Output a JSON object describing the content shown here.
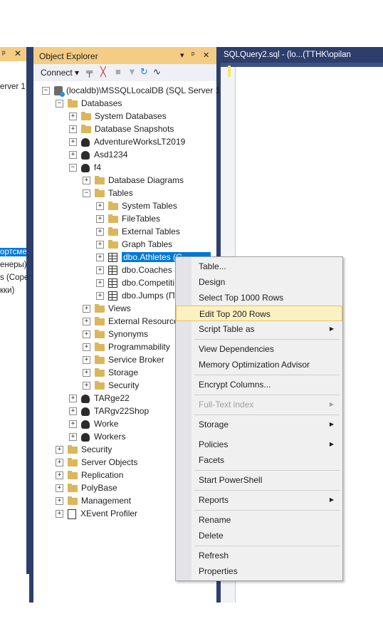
{
  "left_panel": {
    "header_icons": [
      "pin-icon",
      "close-icon"
    ],
    "lines": [
      "erver 1",
      "ортсме",
      "енеры)",
      "s (Соре",
      "кки)"
    ]
  },
  "object_explorer": {
    "title": "Object Explorer",
    "connect_label": "Connect",
    "tree": [
      {
        "label": "(localdb)\\MSSQLLocalDB (SQL Server 1",
        "icon": "server-icon",
        "expander": "−"
      },
      {
        "label": "Databases",
        "icon": "folder-icon",
        "expander": "−"
      },
      {
        "label": "System Databases",
        "icon": "folder-icon",
        "expander": "+"
      },
      {
        "label": "Database Snapshots",
        "icon": "folder-icon",
        "expander": "+"
      },
      {
        "label": "AdventureWorksLT2019",
        "icon": "database-icon",
        "expander": "+"
      },
      {
        "label": "Asd1234",
        "icon": "database-icon",
        "expander": "+"
      },
      {
        "label": "f4",
        "icon": "database-icon",
        "expander": "−"
      },
      {
        "label": "Database Diagrams",
        "icon": "folder-icon",
        "expander": "+"
      },
      {
        "label": "Tables",
        "icon": "folder-icon",
        "expander": "−"
      },
      {
        "label": "System Tables",
        "icon": "folder-icon",
        "expander": "+"
      },
      {
        "label": "FileTables",
        "icon": "folder-icon",
        "expander": "+"
      },
      {
        "label": "External Tables",
        "icon": "folder-icon",
        "expander": "+"
      },
      {
        "label": "Graph Tables",
        "icon": "folder-icon",
        "expander": "+"
      },
      {
        "label": "dbo.Athletes (С",
        "icon": "table-icon",
        "expander": "+"
      },
      {
        "label": "dbo.Coaches",
        "icon": "table-icon",
        "expander": "+"
      },
      {
        "label": "dbo.Competiti",
        "icon": "table-icon",
        "expander": "+"
      },
      {
        "label": "dbo.Jumps (П",
        "icon": "table-icon",
        "expander": "+"
      },
      {
        "label": "Views",
        "icon": "folder-icon",
        "expander": "+"
      },
      {
        "label": "External Resource",
        "icon": "folder-icon",
        "expander": "+"
      },
      {
        "label": "Synonyms",
        "icon": "folder-icon",
        "expander": "+"
      },
      {
        "label": "Programmability",
        "icon": "folder-icon",
        "expander": "+"
      },
      {
        "label": "Service Broker",
        "icon": "folder-icon",
        "expander": "+"
      },
      {
        "label": "Storage",
        "icon": "folder-icon",
        "expander": "+"
      },
      {
        "label": "Security",
        "icon": "folder-icon",
        "expander": "+"
      },
      {
        "label": "TARge22",
        "icon": "database-icon",
        "expander": "+"
      },
      {
        "label": "TARgv22Shop",
        "icon": "database-icon",
        "expander": "+"
      },
      {
        "label": "Worke",
        "icon": "database-icon",
        "expander": "+"
      },
      {
        "label": "Workers",
        "icon": "database-icon",
        "expander": "+"
      },
      {
        "label": "Security",
        "icon": "folder-icon",
        "expander": "+"
      },
      {
        "label": "Server Objects",
        "icon": "folder-icon",
        "expander": "+"
      },
      {
        "label": "Replication",
        "icon": "folder-icon",
        "expander": "+"
      },
      {
        "label": "PolyBase",
        "icon": "folder-icon",
        "expander": "+"
      },
      {
        "label": "Management",
        "icon": "folder-icon",
        "expander": "+"
      },
      {
        "label": "XEvent Profiler",
        "icon": "xevent-icon",
        "expander": "+"
      }
    ]
  },
  "query_tab": {
    "label": "SQLQuery2.sql - (lo...(TTHK\\opilan"
  },
  "context_menu": {
    "items": [
      {
        "label": "Table...",
        "submenu": false,
        "disabled": false
      },
      {
        "label": "Design",
        "submenu": false,
        "disabled": false
      },
      {
        "label": "Select Top 1000 Rows",
        "submenu": false,
        "disabled": false
      },
      {
        "label": "Edit Top 200 Rows",
        "submenu": false,
        "disabled": false,
        "highlighted": true
      },
      {
        "label": "Script Table as",
        "submenu": true,
        "disabled": false
      },
      {
        "label": "View Dependencies",
        "submenu": false,
        "disabled": false
      },
      {
        "label": "Memory Optimization Advisor",
        "submenu": false,
        "disabled": false
      },
      {
        "label": "Encrypt Columns...",
        "submenu": false,
        "disabled": false
      },
      {
        "label": "Full-Text index",
        "submenu": true,
        "disabled": true
      },
      {
        "label": "Storage",
        "submenu": true,
        "disabled": false
      },
      {
        "label": "Policies",
        "submenu": true,
        "disabled": false
      },
      {
        "label": "Facets",
        "submenu": false,
        "disabled": false
      },
      {
        "label": "Start PowerShell",
        "submenu": false,
        "disabled": false
      },
      {
        "label": "Reports",
        "submenu": true,
        "disabled": false
      },
      {
        "label": "Rename",
        "submenu": false,
        "disabled": false
      },
      {
        "label": "Delete",
        "submenu": false,
        "disabled": false
      },
      {
        "label": "Refresh",
        "submenu": false,
        "disabled": false
      },
      {
        "label": "Properties",
        "submenu": false,
        "disabled": false
      }
    ]
  },
  "colors": {
    "frame": "#2c3e6b",
    "header_active": "#f5cc84",
    "selection": "#0078d7",
    "menu_highlight": "#fcf1c2"
  }
}
